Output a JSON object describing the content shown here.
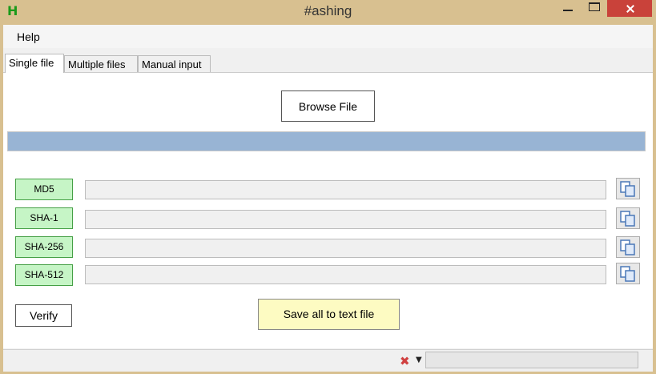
{
  "window": {
    "app_icon": "H",
    "title": "#ashing"
  },
  "menu": {
    "help": "Help"
  },
  "tabs": [
    {
      "label": "Single file"
    },
    {
      "label": "Multiple files"
    },
    {
      "label": "Manual input"
    }
  ],
  "single_file": {
    "browse_label": "Browse File",
    "hashes": [
      {
        "label": "MD5",
        "value": ""
      },
      {
        "label": "SHA-1",
        "value": ""
      },
      {
        "label": "SHA-256",
        "value": ""
      },
      {
        "label": "SHA-512",
        "value": ""
      }
    ],
    "verify_label": "Verify",
    "save_label": "Save all to text file"
  },
  "status": {
    "icon": "✖",
    "dropdown": "▼"
  },
  "colors": {
    "accent_progress": "#98b4d4",
    "hash_label_bg": "#c6f5c6",
    "save_bg": "#fdfbc2",
    "close_button": "#c9423a"
  }
}
